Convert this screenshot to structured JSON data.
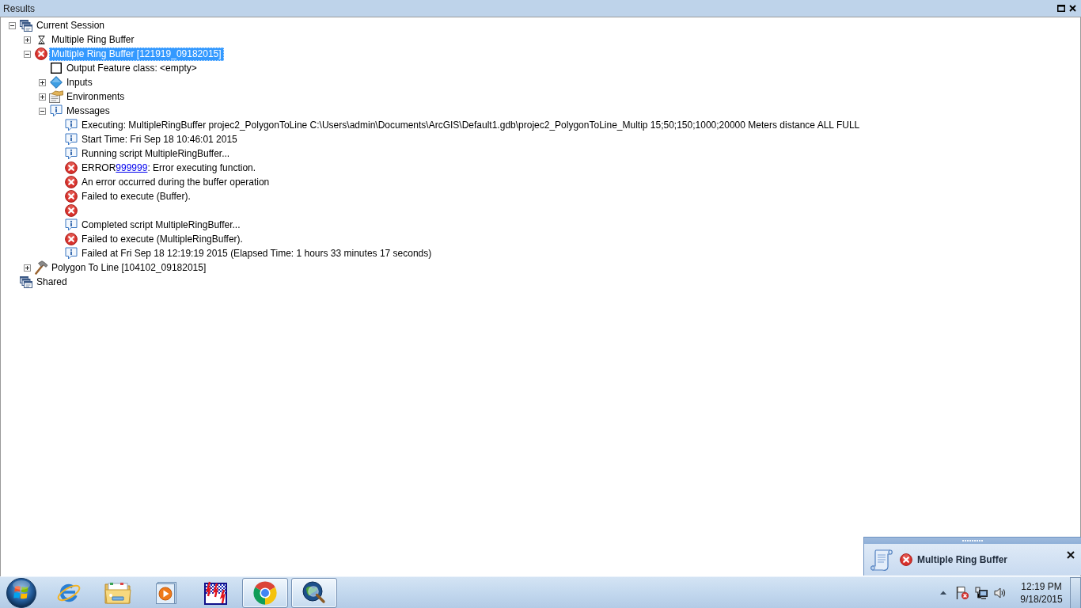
{
  "panel": {
    "title": "Results"
  },
  "tree": [
    {
      "kind": "session",
      "label": "Current Session",
      "expanded": true,
      "selected": false,
      "children": [
        {
          "kind": "running",
          "label": "Multiple Ring Buffer",
          "expanded": false,
          "selected": false
        },
        {
          "kind": "failed",
          "label": "Multiple Ring Buffer [121919_09182015]",
          "expanded": true,
          "selected": true,
          "children": [
            {
              "kind": "output",
              "label": "Output Feature class: <empty>",
              "selected": false
            },
            {
              "kind": "inputs",
              "label": "Inputs",
              "expanded": false,
              "selected": false
            },
            {
              "kind": "environments",
              "label": "Environments",
              "expanded": false,
              "selected": false
            },
            {
              "kind": "messages",
              "label": "Messages",
              "expanded": true,
              "selected": false,
              "children": [
                {
                  "kind": "info",
                  "label": "Executing: MultipleRingBuffer projec2_PolygonToLine C:\\Users\\admin\\Documents\\ArcGIS\\Default1.gdb\\projec2_PolygonToLine_Multip 15;50;150;1000;20000 Meters distance ALL FULL",
                  "selected": false
                },
                {
                  "kind": "info",
                  "label": "Start Time: Fri Sep 18 10:46:01 2015",
                  "selected": false
                },
                {
                  "kind": "info",
                  "label": "Running script MultipleRingBuffer...",
                  "selected": false
                },
                {
                  "kind": "error",
                  "label": "ERROR",
                  "link": "999999",
                  "label_after": ": Error executing function.",
                  "selected": false
                },
                {
                  "kind": "error",
                  "label": "An error occurred during the buffer operation",
                  "selected": false
                },
                {
                  "kind": "error",
                  "label": "Failed to execute (Buffer).",
                  "selected": false
                },
                {
                  "kind": "error",
                  "selected": false
                },
                {
                  "kind": "info",
                  "label": "Completed script MultipleRingBuffer...",
                  "selected": false
                },
                {
                  "kind": "error",
                  "label": "Failed to execute (MultipleRingBuffer).",
                  "selected": false
                },
                {
                  "kind": "info",
                  "label": "Failed at Fri Sep 18 12:19:19 2015 (Elapsed Time: 1 hours 33 minutes 17 seconds)",
                  "selected": false
                }
              ]
            }
          ]
        },
        {
          "kind": "done",
          "label": "Polygon To Line [104102_09182015]",
          "expanded": false,
          "selected": false
        }
      ]
    },
    {
      "kind": "session",
      "label": "Shared",
      "selected": false
    }
  ],
  "notification": {
    "title": "Multiple Ring Buffer"
  },
  "taskbar": {
    "apps": [
      {
        "kind": "internet",
        "running": false
      },
      {
        "kind": "folder",
        "running": false
      },
      {
        "kind": "player",
        "running": false
      },
      {
        "kind": "drawing",
        "running": false
      },
      {
        "kind": "browser",
        "running": true
      },
      {
        "kind": "globe",
        "running": true
      }
    ]
  },
  "tray": {
    "time": "12:19 PM",
    "date": "9/18/2015"
  }
}
